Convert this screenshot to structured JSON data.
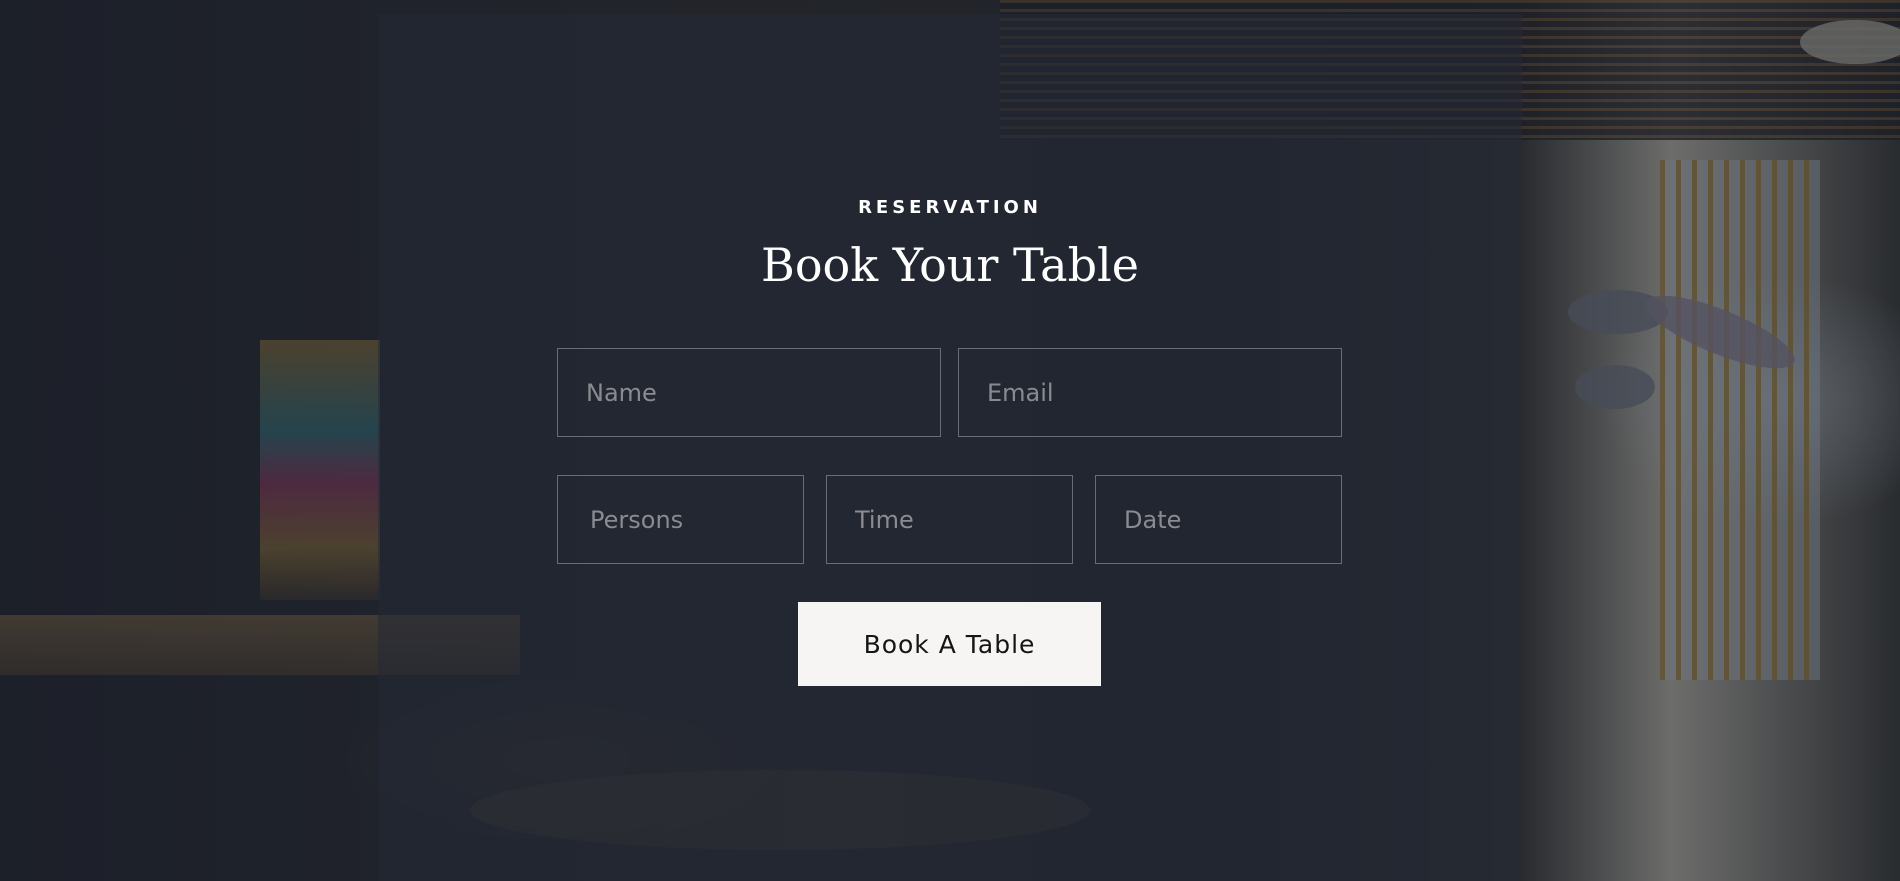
{
  "reservation": {
    "eyebrow": "RESERVATION",
    "title": "Book Your Table",
    "fields": {
      "name_placeholder": "Name",
      "email_placeholder": "Email",
      "persons_placeholder": "Persons",
      "time_placeholder": "Time",
      "date_placeholder": "Date"
    },
    "submit_label": "Book A Table"
  },
  "colors": {
    "overlay": "#1c202b",
    "button_bg": "#f6f5f4",
    "text": "#ffffff"
  }
}
